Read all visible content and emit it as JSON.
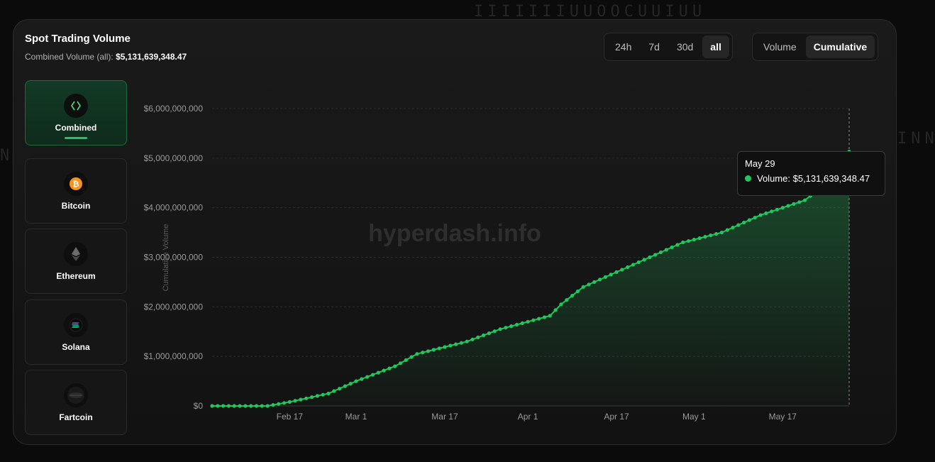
{
  "header": {
    "title": "Spot Trading Volume",
    "subtitle_label": "Combined Volume (all):",
    "subtitle_value": "$5,131,639,348.47"
  },
  "range_tabs": [
    "24h",
    "7d",
    "30d",
    "all"
  ],
  "range_selected": "all",
  "mode_tabs": [
    "Volume",
    "Cumulative"
  ],
  "mode_selected": "Cumulative",
  "assets": [
    {
      "label": "Combined",
      "icon": "combined-icon"
    },
    {
      "label": "Bitcoin",
      "icon": "bitcoin-icon"
    },
    {
      "label": "Ethereum",
      "icon": "ethereum-icon"
    },
    {
      "label": "Solana",
      "icon": "solana-icon"
    },
    {
      "label": "Fartcoin",
      "icon": "fartcoin-icon"
    }
  ],
  "asset_selected": "Combined",
  "watermark": "hyperdash.info",
  "tooltip": {
    "date": "May 29",
    "label": "Volume:",
    "value": "$5,131,639,348.47"
  },
  "colors": {
    "accent": "#22c55e",
    "background": "#0b0b0b",
    "card": "#161616"
  },
  "chart_data": {
    "type": "area",
    "ylabel": "Cumulative Volume",
    "ylim": [
      0,
      6000000000
    ],
    "yticks": [
      "$0",
      "$1,000,000,000",
      "$2,000,000,000",
      "$3,000,000,000",
      "$4,000,000,000",
      "$5,000,000,000",
      "$6,000,000,000"
    ],
    "xlim": [
      "2025-02-03",
      "2025-05-29"
    ],
    "xticks": [
      {
        "label": "Feb 17",
        "date": "2025-02-17"
      },
      {
        "label": "Mar 1",
        "date": "2025-03-01"
      },
      {
        "label": "Mar 17",
        "date": "2025-03-17"
      },
      {
        "label": "Apr 1",
        "date": "2025-04-01"
      },
      {
        "label": "Apr 17",
        "date": "2025-04-17"
      },
      {
        "label": "May 1",
        "date": "2025-05-01"
      },
      {
        "label": "May 17",
        "date": "2025-05-17"
      }
    ],
    "grid": true,
    "series": [
      {
        "points": [
          [
            "2025-02-03",
            0
          ],
          [
            "2025-02-13",
            0
          ],
          [
            "2025-02-17",
            80000000
          ],
          [
            "2025-02-24",
            250000000
          ],
          [
            "2025-03-01",
            500000000
          ],
          [
            "2025-03-08",
            800000000
          ],
          [
            "2025-03-12",
            1050000000
          ],
          [
            "2025-03-21",
            1300000000
          ],
          [
            "2025-03-27",
            1550000000
          ],
          [
            "2025-04-01",
            1700000000
          ],
          [
            "2025-04-05",
            1820000000
          ],
          [
            "2025-04-07",
            2050000000
          ],
          [
            "2025-04-11",
            2400000000
          ],
          [
            "2025-04-18",
            2750000000
          ],
          [
            "2025-04-23",
            3000000000
          ],
          [
            "2025-04-29",
            3300000000
          ],
          [
            "2025-05-06",
            3500000000
          ],
          [
            "2025-05-13",
            3850000000
          ],
          [
            "2025-05-21",
            4150000000
          ],
          [
            "2025-05-25",
            4500000000
          ],
          [
            "2025-05-29",
            5131639348.47
          ]
        ]
      }
    ]
  }
}
